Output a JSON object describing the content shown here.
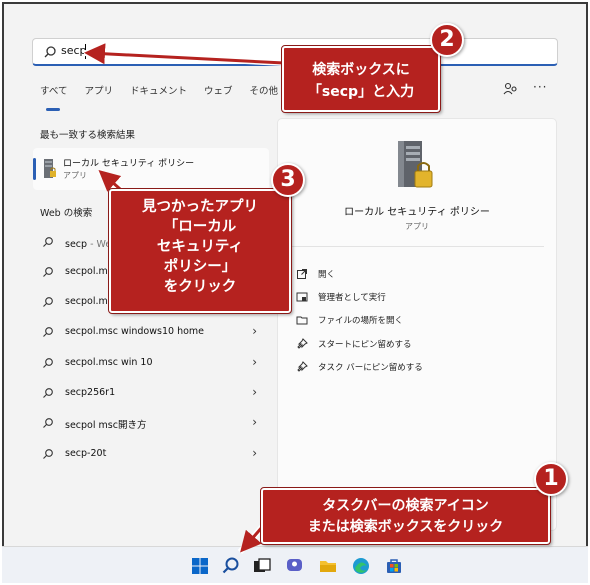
{
  "search": {
    "value": "secp"
  },
  "tabs": [
    {
      "label": "すべて"
    },
    {
      "label": "アプリ"
    },
    {
      "label": "ドキュメント"
    },
    {
      "label": "ウェブ"
    },
    {
      "label": "その他 ⌵"
    }
  ],
  "best_match": {
    "heading": "最も一致する検索結果",
    "name": "ローカル セキュリティ ポリシー",
    "type": "アプリ"
  },
  "web": {
    "heading": "Web の検索",
    "items": [
      {
        "text": "secp",
        "suffix": " - Web 結果を見る"
      },
      {
        "text": "secpol.msc",
        "suffix": ""
      },
      {
        "text": "secpol.msc",
        "suffix": ""
      },
      {
        "text": "secpol.msc windows10 home",
        "suffix": ""
      },
      {
        "text": "secpol.msc win 10",
        "suffix": ""
      },
      {
        "text": "secp256r1",
        "suffix": ""
      },
      {
        "text": "secpol msc開き方",
        "suffix": ""
      },
      {
        "text": "secp-20t",
        "suffix": ""
      }
    ]
  },
  "preview": {
    "title": "ローカル セキュリティ ポリシー",
    "type": "アプリ",
    "actions": [
      {
        "label": "開く",
        "icon": "open-icon"
      },
      {
        "label": "管理者として実行",
        "icon": "run-as-admin-icon"
      },
      {
        "label": "ファイルの場所を開く",
        "icon": "folder-icon"
      },
      {
        "label": "スタートにピン留めする",
        "icon": "pin-icon"
      },
      {
        "label": "タスク バーにピン留めする",
        "icon": "pin-icon"
      }
    ]
  },
  "callouts": {
    "step1": {
      "number": "1",
      "line1": "タスクバーの検索アイコン",
      "line2": "または検索ボックスをクリック"
    },
    "step2": {
      "number": "2",
      "line1": "検索ボックスに",
      "line2": "「secp」と入力"
    },
    "step3": {
      "number": "3",
      "line1": "見つかったアプリ",
      "line2": "「ローカル",
      "line3": "セキュリティ",
      "line4": "ポリシー」",
      "line5": "をクリック"
    }
  },
  "colors": {
    "accent": "#2b5fb4",
    "callout": "#b5221f"
  }
}
